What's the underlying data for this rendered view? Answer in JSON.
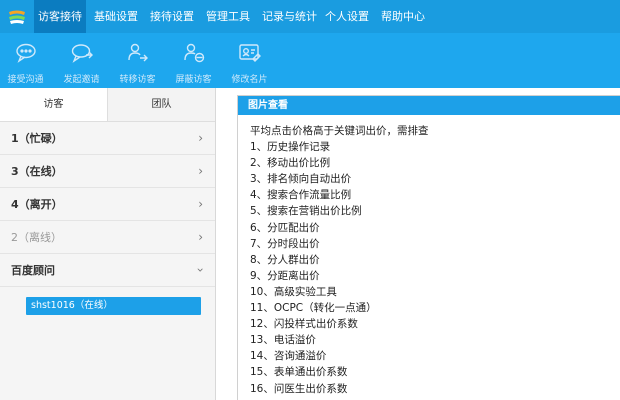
{
  "menu": {
    "items": [
      {
        "label": "访客接待",
        "active": true
      },
      {
        "label": "基础设置",
        "active": false
      },
      {
        "label": "接待设置",
        "active": false
      },
      {
        "label": "管理工具",
        "active": false
      },
      {
        "label": "记录与统计",
        "active": false
      },
      {
        "label": "个人设置",
        "active": false
      },
      {
        "label": "帮助中心",
        "active": false
      }
    ]
  },
  "toolbar": {
    "items": [
      {
        "label": "接受沟通",
        "icon": "chat-icon"
      },
      {
        "label": "发起邀请",
        "icon": "invite-icon"
      },
      {
        "label": "转移访客",
        "icon": "transfer-icon"
      },
      {
        "label": "屏蔽访客",
        "icon": "block-icon"
      },
      {
        "label": "修改名片",
        "icon": "card-icon"
      }
    ]
  },
  "left": {
    "tabs": [
      {
        "label": "访客",
        "active": true
      },
      {
        "label": "团队",
        "active": false
      }
    ],
    "groups": [
      {
        "label": "1（忙碌）",
        "muted": false,
        "expanded": false
      },
      {
        "label": "3（在线）",
        "muted": false,
        "expanded": false
      },
      {
        "label": "4（离开）",
        "muted": false,
        "expanded": false
      },
      {
        "label": "2（离线）",
        "muted": true,
        "expanded": false
      },
      {
        "label": "百度顾问",
        "muted": false,
        "expanded": true
      }
    ],
    "visitor": "shst1016（在线）"
  },
  "panel": {
    "title": "图片查看",
    "lines": [
      "平均点击价格高于关键词出价，需排查",
      "1、历史操作记录",
      "2、移动出价比例",
      "3、排名倾向自动出价",
      "4、搜索合作流量比例",
      "5、搜索在营销出价比例",
      "6、分匹配出价",
      "7、分时段出价",
      "8、分人群出价",
      "9、分距离出价",
      "10、高级实验工具",
      "11、OCPC（转化一点通）",
      "12、闪投样式出价系数",
      "13、电话溢价",
      "14、咨询通溢价",
      "15、表单通出价系数",
      "16、问医生出价系数"
    ]
  },
  "colors": {
    "menubar": "#1a9ce0",
    "menu_active": "#0b7cc0",
    "toolbar": "#1ea7ee",
    "accent": "#1da0e8"
  }
}
